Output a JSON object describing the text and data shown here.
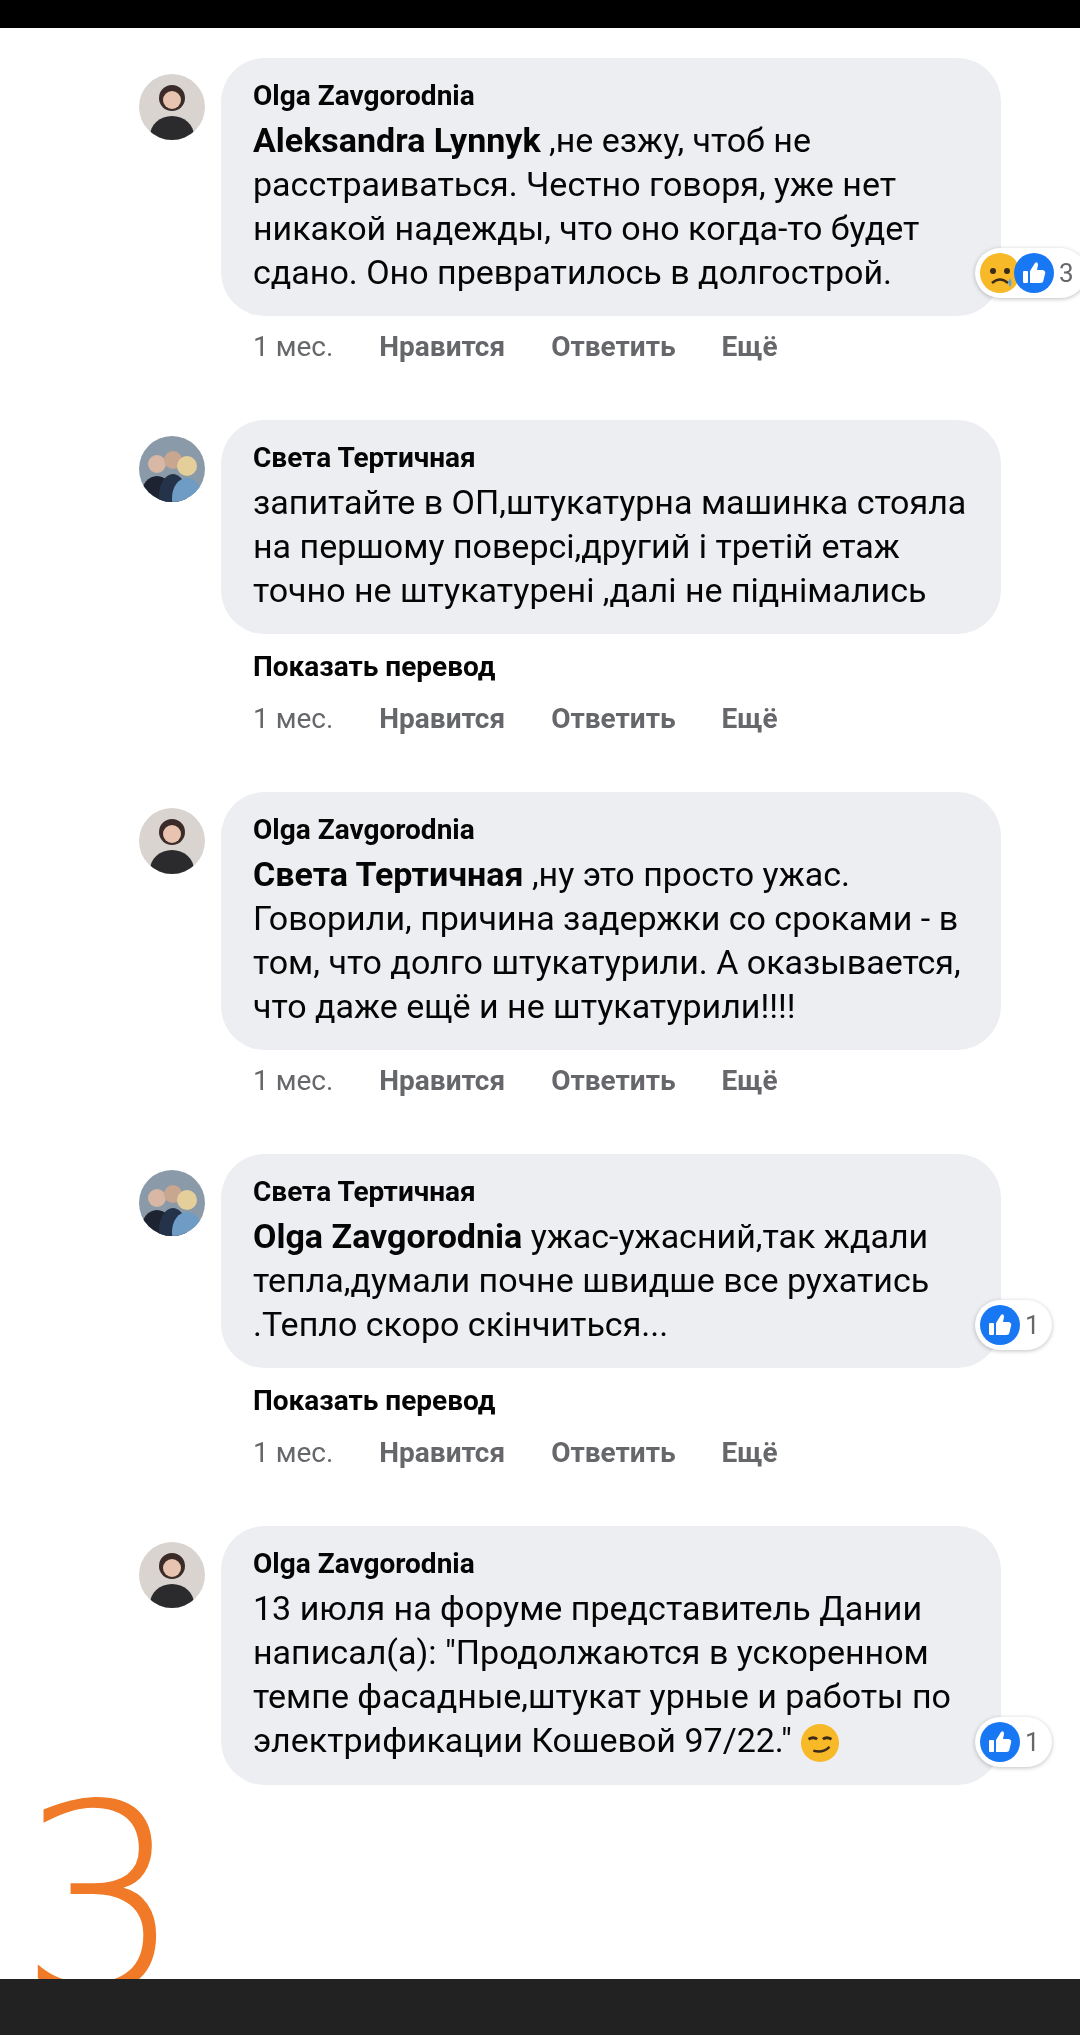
{
  "comments": [
    {
      "author": "Olga Zavgorodnia",
      "text": "**Aleksandra Lynnyk** ,не езжу, чтоб не расстраиваться. Честно говоря, уже нет никакой надежды, что оно когда-то будет сдано. Оно превратилось в долгострой.",
      "reactions": [
        {
          "kind": "sad"
        },
        {
          "kind": "like"
        }
      ],
      "reaction_count": "3",
      "time": "1 мес.",
      "actions": [
        "Нравится",
        "Ответить",
        "Ещё"
      ]
    },
    {
      "author": "Света Тертичная",
      "text": "запитайте в ОП,штукатурна машинка стояла на першому поверсі,другий і третій етаж точно не штукатурені ,далі не піднімались",
      "translate": "Показать перевод",
      "time": "1 мес.",
      "actions": [
        "Нравится",
        "Ответить",
        "Ещё"
      ]
    },
    {
      "author": "Olga Zavgorodnia",
      "text": "**Света Тертичная** ,ну это просто ужас. Говорили, причина задержки со сроками - в том, что долго штукатурили. А оказывается, что даже ещё и не штукатурили!!!!",
      "time": "1 мес.",
      "actions": [
        "Нравится",
        "Ответить",
        "Ещё"
      ]
    },
    {
      "author": "Света Тертичная",
      "text": "**Olga Zavgorodnia** ужас-ужасний,так ждали тепла,думали почне швидше все рухатись .Тепло скоро скінчиться...",
      "reactions": [
        {
          "kind": "like"
        }
      ],
      "reaction_count": "1",
      "translate": "Показать перевод",
      "time": "1 мес.",
      "actions": [
        "Нравится",
        "Ответить",
        "Ещё"
      ]
    },
    {
      "author": "Olga Zavgorodnia",
      "text": "13 июля на форуме представитель Дании написал(а): \"Продолжаются в ускоренном темпе фасадные,штукат урные и работы по электрификации Кошевой 97/22.\"",
      "emoji": {
        "kind": "smirk"
      },
      "reactions": [
        {
          "kind": "like"
        }
      ],
      "reaction_count": "1"
    }
  ],
  "annotation": "3"
}
